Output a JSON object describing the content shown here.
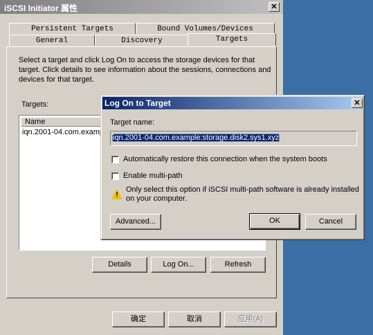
{
  "main_window": {
    "title": "iSCSI Initiator 属性",
    "tabs_row1": [
      "Persistent Targets",
      "Bound Volumes/Devices"
    ],
    "tabs_row2": [
      "General",
      "Discovery",
      "Targets"
    ],
    "description": "Select a target and click Log On to access the storage devices for that target. Click details to see information about the sessions, connections and devices for that target.",
    "targets_label": "Targets:",
    "list_header_name": "Name",
    "targets": [
      "iqn.2001-04.com.examp"
    ],
    "details_button": "Details",
    "logon_button": "Log On...",
    "refresh_button": "Refresh",
    "ok_button": "确定",
    "cancel_button": "取消",
    "apply_button": "应用(A)"
  },
  "logon_dialog": {
    "title": "Log On to Target",
    "target_name_label": "Target name:",
    "target_name_value": "iqn.2001-04.com.example:storage.disk2.sys1.xyz",
    "auto_restore_label": "Automatically restore this connection when the system boots",
    "auto_restore_checked": false,
    "multipath_label": "Enable multi-path",
    "multipath_checked": false,
    "warning_text": "Only select this option if iSCSI multi-path software is already installed on your computer.",
    "advanced_button": "Advanced...",
    "ok_button": "OK",
    "cancel_button": "Cancel"
  }
}
